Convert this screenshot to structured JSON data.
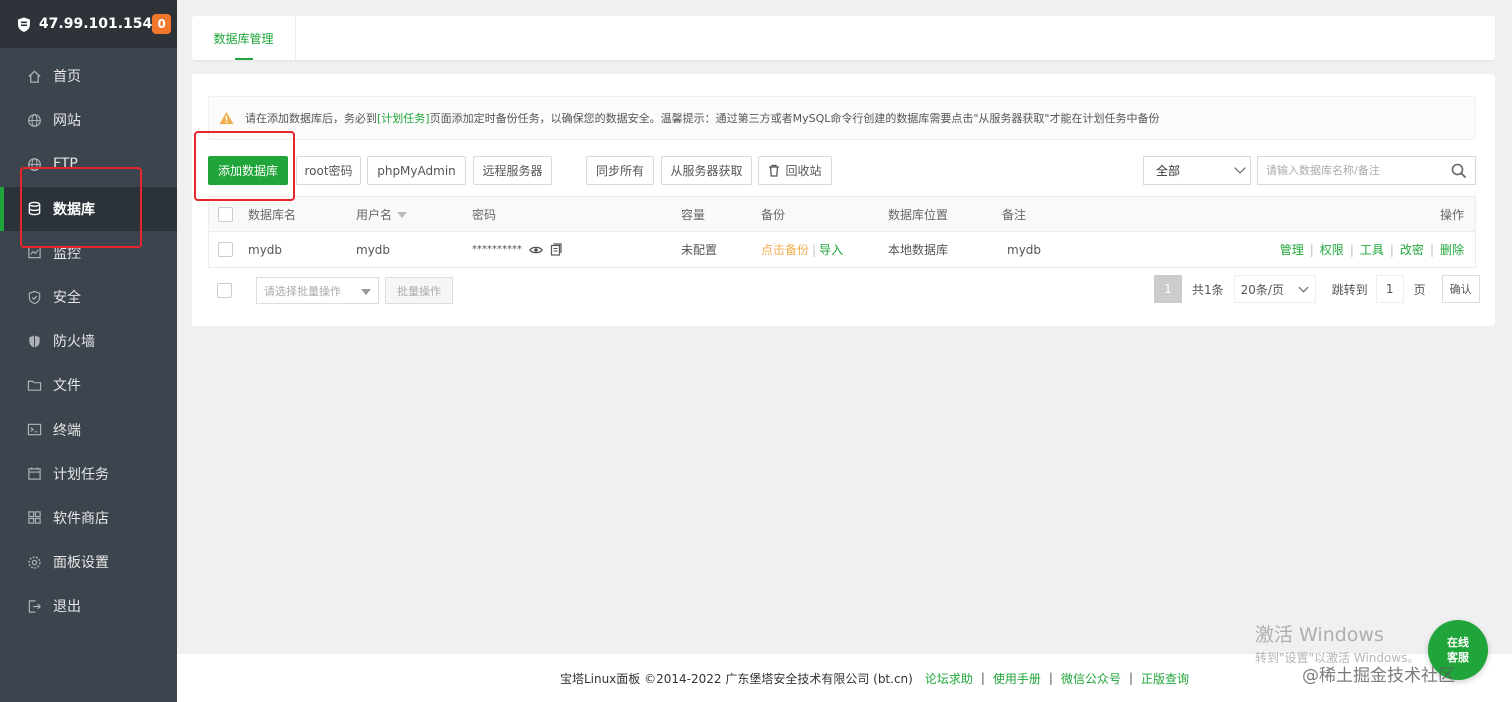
{
  "sidebar": {
    "ip": "47.99.101.154",
    "badge": "0",
    "items": [
      {
        "label": "首页",
        "icon": "home-icon"
      },
      {
        "label": "网站",
        "icon": "globe-icon"
      },
      {
        "label": "FTP",
        "icon": "globe-icon"
      },
      {
        "label": "数据库",
        "icon": "database-icon",
        "active": true
      },
      {
        "label": "监控",
        "icon": "monitor-icon"
      },
      {
        "label": "安全",
        "icon": "shield-icon"
      },
      {
        "label": "防火墙",
        "icon": "firewall-icon"
      },
      {
        "label": "文件",
        "icon": "folder-icon"
      },
      {
        "label": "终端",
        "icon": "terminal-icon"
      },
      {
        "label": "计划任务",
        "icon": "calendar-icon"
      },
      {
        "label": "软件商店",
        "icon": "grid-icon"
      },
      {
        "label": "面板设置",
        "icon": "settings-icon"
      },
      {
        "label": "退出",
        "icon": "logout-icon"
      }
    ]
  },
  "tab": {
    "label": "数据库管理"
  },
  "notice": {
    "prefix": "请在添加数据库后，务必到",
    "link": "[计划任务]",
    "suffix": "页面添加定时备份任务，以确保您的数据安全。温馨提示：通过第三方或者MySQL命令行创建的数据库需要点击\"从服务器获取\"才能在计划任务中备份"
  },
  "toolbar": {
    "add_db": "添加数据库",
    "root_pw": "root密码",
    "phpmyadmin": "phpMyAdmin",
    "remote": "远程服务器",
    "sync_all": "同步所有",
    "from_server": "从服务器获取",
    "recycle": "回收站",
    "filter": "全部",
    "search_placeholder": "请输入数据库名称/备注"
  },
  "table": {
    "headers": {
      "name": "数据库名",
      "user": "用户名",
      "password": "密码",
      "capacity": "容量",
      "backup": "备份",
      "location": "数据库位置",
      "note": "备注",
      "ops": "操作"
    },
    "rows": [
      {
        "name": "mydb",
        "user": "mydb",
        "password": "**********",
        "capacity": "未配置",
        "backup": "点击备份",
        "import": "导入",
        "location": "本地数据库",
        "note": "mydb",
        "actions": [
          "管理",
          "权限",
          "工具",
          "改密",
          "删除"
        ]
      }
    ]
  },
  "batch": {
    "select_placeholder": "请选择批量操作",
    "button": "批量操作"
  },
  "pagination": {
    "current": "1",
    "total": "共1条",
    "per_page": "20条/页",
    "goto_label": "跳转到",
    "goto_value": "1",
    "page_unit": "页",
    "confirm": "确认"
  },
  "footer": {
    "copyright": "宝塔Linux面板 ©2014-2022 广东堡塔安全技术有限公司 (bt.cn)",
    "links": [
      "论坛求助",
      "使用手册",
      "微信公众号",
      "正版查询"
    ]
  },
  "overlay": {
    "activate_title": "激活 Windows",
    "activate_sub": "转到\"设置\"以激活 Windows。",
    "service_line1": "在线",
    "service_line2": "客服",
    "watermark": "@稀土掘金技术社区"
  },
  "colors": {
    "accent": "#20a53a",
    "sidebar": "#3c444d",
    "badge": "#f0772b",
    "annotation": "#e7262b",
    "backup_link": "#f0ad4e"
  }
}
